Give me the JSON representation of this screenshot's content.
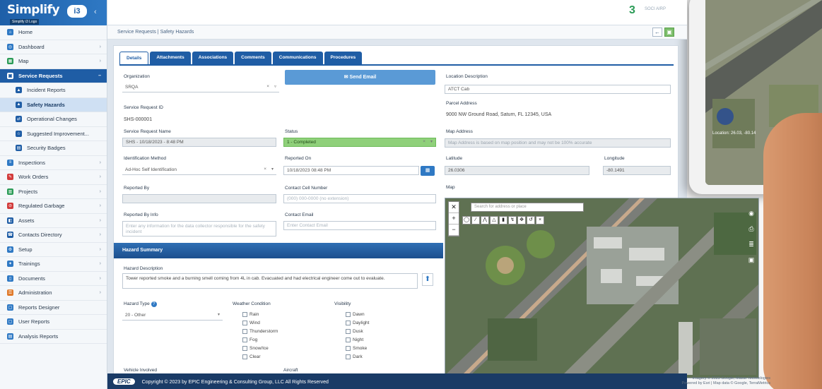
{
  "app": {
    "logo": "Simplify",
    "logo_badge": "i3",
    "tooltip": "Simplify i3 Logo",
    "brand": "3",
    "brand_sub": "SOCI\nAIRP"
  },
  "sidebar": {
    "items": [
      {
        "label": "Home",
        "color": "#2f79c4"
      },
      {
        "label": "Dashboard",
        "color": "#2f79c4"
      },
      {
        "label": "Map",
        "color": "#2a9b56"
      },
      {
        "label": "Service Requests",
        "color": "#ffffff"
      },
      {
        "label": "Incident Reports",
        "color": "#1f5da5"
      },
      {
        "label": "Safety Hazards",
        "color": "#1f5da5"
      },
      {
        "label": "Operational Changes",
        "color": "#1f5da5"
      },
      {
        "label": "Suggested Improvement...",
        "color": "#1f5da5"
      },
      {
        "label": "Security Badges",
        "color": "#1f5da5"
      },
      {
        "label": "Inspections",
        "color": "#2f79c4"
      },
      {
        "label": "Work Orders",
        "color": "#d23b3b"
      },
      {
        "label": "Projects",
        "color": "#2a9b56"
      },
      {
        "label": "Regulated Garbage",
        "color": "#d23b3b"
      },
      {
        "label": "Assets",
        "color": "#1f5da5"
      },
      {
        "label": "Contacts Directory",
        "color": "#1f5da5"
      },
      {
        "label": "Setup",
        "color": "#2f79c4"
      },
      {
        "label": "Trainings",
        "color": "#2f79c4"
      },
      {
        "label": "Documents",
        "color": "#2f79c4"
      },
      {
        "label": "Administration",
        "color": "#e07a2b"
      },
      {
        "label": "Reports Designer",
        "color": "#2f79c4"
      },
      {
        "label": "User Reports",
        "color": "#2f79c4"
      },
      {
        "label": "Analysis Reports",
        "color": "#2f79c4"
      }
    ]
  },
  "breadcrumb": {
    "text": "Service Requests  |  Safety Hazards"
  },
  "tabs": [
    "Details",
    "Attachments",
    "Associations",
    "Comments",
    "Communications",
    "Procedures"
  ],
  "form": {
    "organization_label": "Organization",
    "organization_value": "SRQA",
    "sr_id_label": "Service Request ID",
    "sr_id_value": "SHS-000001",
    "sr_name_label": "Service Request Name",
    "sr_name_value": "SHS - 10/18/2023 - 8:48 PM",
    "status_label": "Status",
    "status_value": "1 - Completed",
    "method_label": "Identification Method",
    "method_value": "Ad-Hoc Self Identification",
    "reported_label": "Reported On",
    "reported_value": "10/18/2023 08:48 PM",
    "reported_by_label": "Reported By",
    "reported_by_value": "",
    "phone_label": "Contact Cell Number",
    "phone_placeholder": "(000) 000-0000 (no extension)",
    "reported_info_label": "Reported By Info",
    "reported_info_placeholder": "Enter any information for the data collector responsible for the safety incident",
    "email_label": "Contact Email",
    "email_placeholder": "Enter Contact Email",
    "send_email": "Send Email",
    "location_label": "Location Description",
    "location_value": "ATCT Cab",
    "parcel_label": "Parcel Address",
    "parcel_value": "9000 NW Ground Road, Saturn, FL 12345, USA",
    "map_address_label": "Map Address",
    "map_address_value": "Map Address is based on map position and may not be 100% accurate",
    "lat_label": "Latitude",
    "lat_value": "26.0306",
    "lon_label": "Longitude",
    "lon_value": "-80.1491",
    "map_label": "Map",
    "section_title": "Hazard Summary",
    "hazard_desc_label": "Hazard Description",
    "hazard_desc_value": "Tower reported smoke and a burning smell coming from 4L in cab. Evacuated and had electrical engineer come out to evaluate.",
    "hazard_type_label": "Hazard Type",
    "hazard_type_value": "20 - Other",
    "weather_label": "Weather Condition",
    "weather_options": [
      "Rain",
      "Wind",
      "Thunderstorm",
      "Fog",
      "Snow/Ice",
      "Clear"
    ],
    "visibility_label": "Visibility",
    "visibility_options": [
      "Dawn",
      "Daylight",
      "Dusk",
      "Night",
      "Smoke",
      "Dark"
    ],
    "vehicle_label": "Vehicle Involved",
    "aircraft_label": "Aircraft"
  },
  "map": {
    "search_placeholder": "Search for address or place"
  },
  "tablet": {
    "caption": "Location: 26.03, -80.14"
  },
  "footer": {
    "epic": "EPIC",
    "copyright": "Copyright © 2023 by EPIC Engineering & Consulting Group, LLC All Rights Reserved",
    "note1": "Imagery © 2023 Google, Maxar Technologies",
    "note2": "Powered by Esri | Map data © Google, TerraMetrics"
  }
}
